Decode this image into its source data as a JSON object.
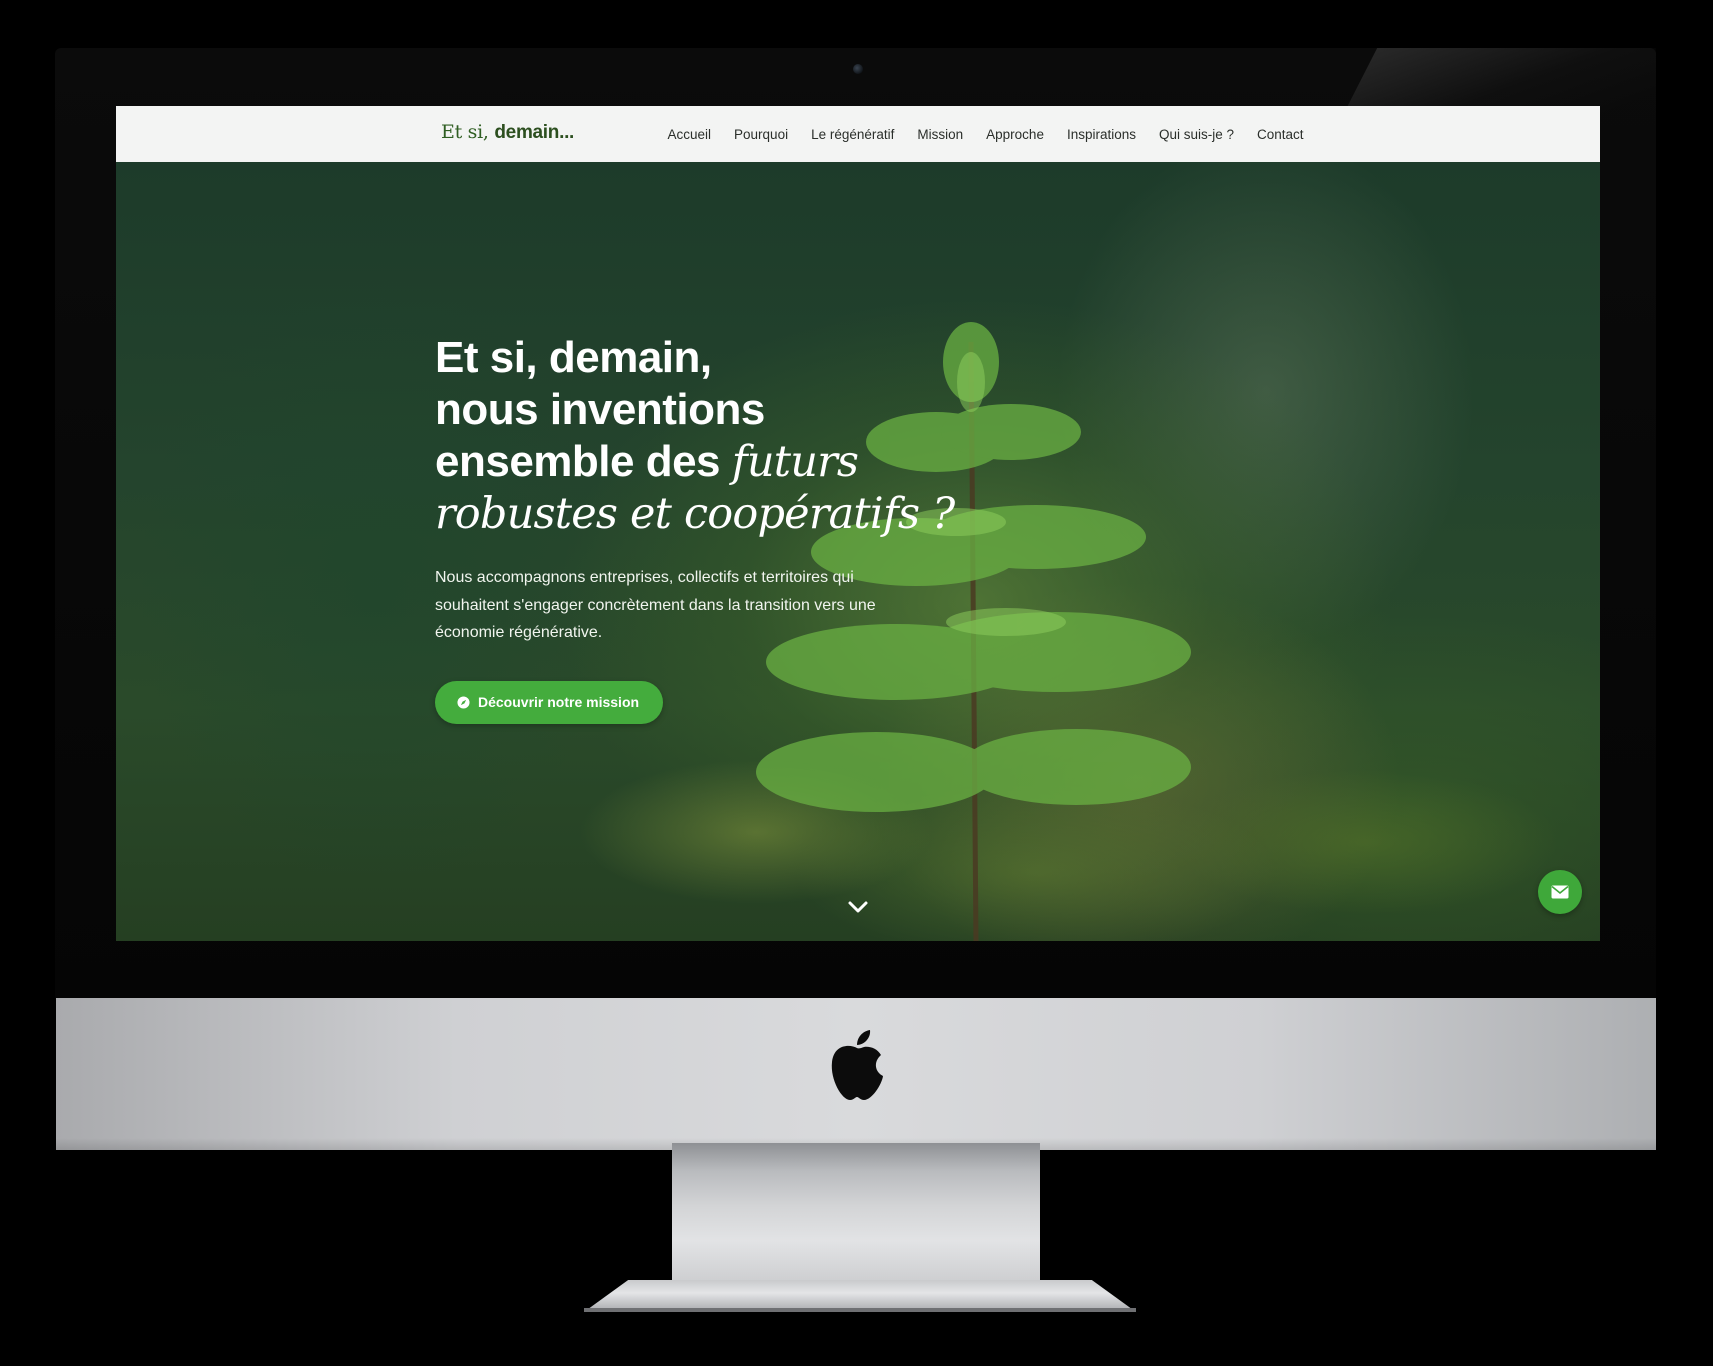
{
  "window": {
    "logo": {
      "part1": "Et si,",
      "part2": "demain..."
    }
  },
  "nav": {
    "items": [
      {
        "label": "Accueil"
      },
      {
        "label": "Pourquoi"
      },
      {
        "label": "Le régénératif"
      },
      {
        "label": "Mission"
      },
      {
        "label": "Approche"
      },
      {
        "label": "Inspirations"
      },
      {
        "label": "Qui suis-je ?"
      },
      {
        "label": "Contact"
      }
    ]
  },
  "hero": {
    "title_line1": "Et si, demain,",
    "title_line2": "nous inventions",
    "title_line3": "ensemble des",
    "title_italic1": "futurs",
    "title_italic2": "robustes et coopératifs ?",
    "description": "Nous accompagnons entreprises, collectifs et territoires qui souhaitent s'engager concrètement dans la transition vers une économie régénérative.",
    "cta_label": "Découvrir notre mission",
    "cta_icon": "compass-icon",
    "scroll_icon": "chevron-down-icon"
  },
  "fab": {
    "icon": "envelope-icon"
  },
  "device": {
    "brand_icon": "apple-logo-icon"
  },
  "colors": {
    "brand_green": "#44ac3d",
    "logo_green": "#2f5e22",
    "navbar_bg": "#f3f4f3"
  }
}
